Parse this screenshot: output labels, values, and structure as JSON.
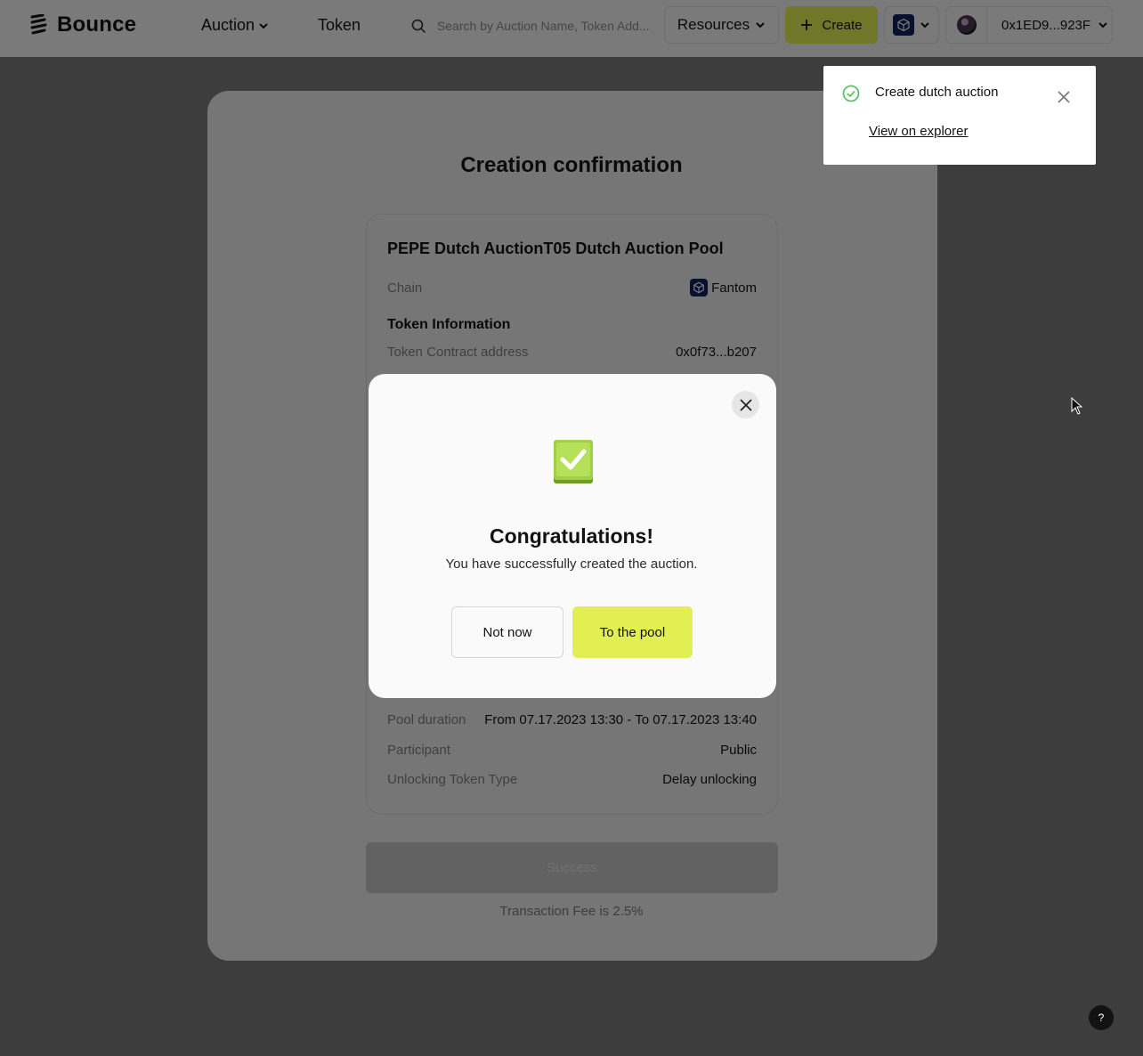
{
  "header": {
    "logo_text": "Bounce",
    "nav": {
      "auction": "Auction",
      "token": "Token"
    },
    "search_placeholder": "Search by Auction Name, Token Add...",
    "resources": "Resources",
    "create": "Create",
    "wallet_address": "0x1ED9...923F"
  },
  "page": {
    "title": "Creation confirmation",
    "pool_name": "PEPE Dutch AuctionT05 Dutch Auction Pool",
    "chain_label": "Chain",
    "chain_value": "Fantom",
    "token_section": "Token Information",
    "contract_label": "Token Contract address",
    "contract_value": "0x0f73...b207",
    "duration_label": "Pool duration",
    "duration_value": "From 07.17.2023 13:30 - To 07.17.2023 13:40",
    "participant_label": "Participant",
    "participant_value": "Public",
    "unlocking_label": "Unlocking Token Type",
    "unlocking_value": "Delay unlocking",
    "success_button": "Success",
    "fee_text": "Transaction Fee is 2.5%"
  },
  "modal": {
    "title": "Congratulations!",
    "subtitle": "You have successfully created the auction.",
    "not_now": "Not now",
    "to_pool": "To the pool"
  },
  "toast": {
    "title": "Create dutch auction",
    "link": "View on explorer"
  },
  "help": "?",
  "colors": {
    "accent": "#e2ef52",
    "success_green": "#5bc26a",
    "chain_navy": "#13215c"
  }
}
